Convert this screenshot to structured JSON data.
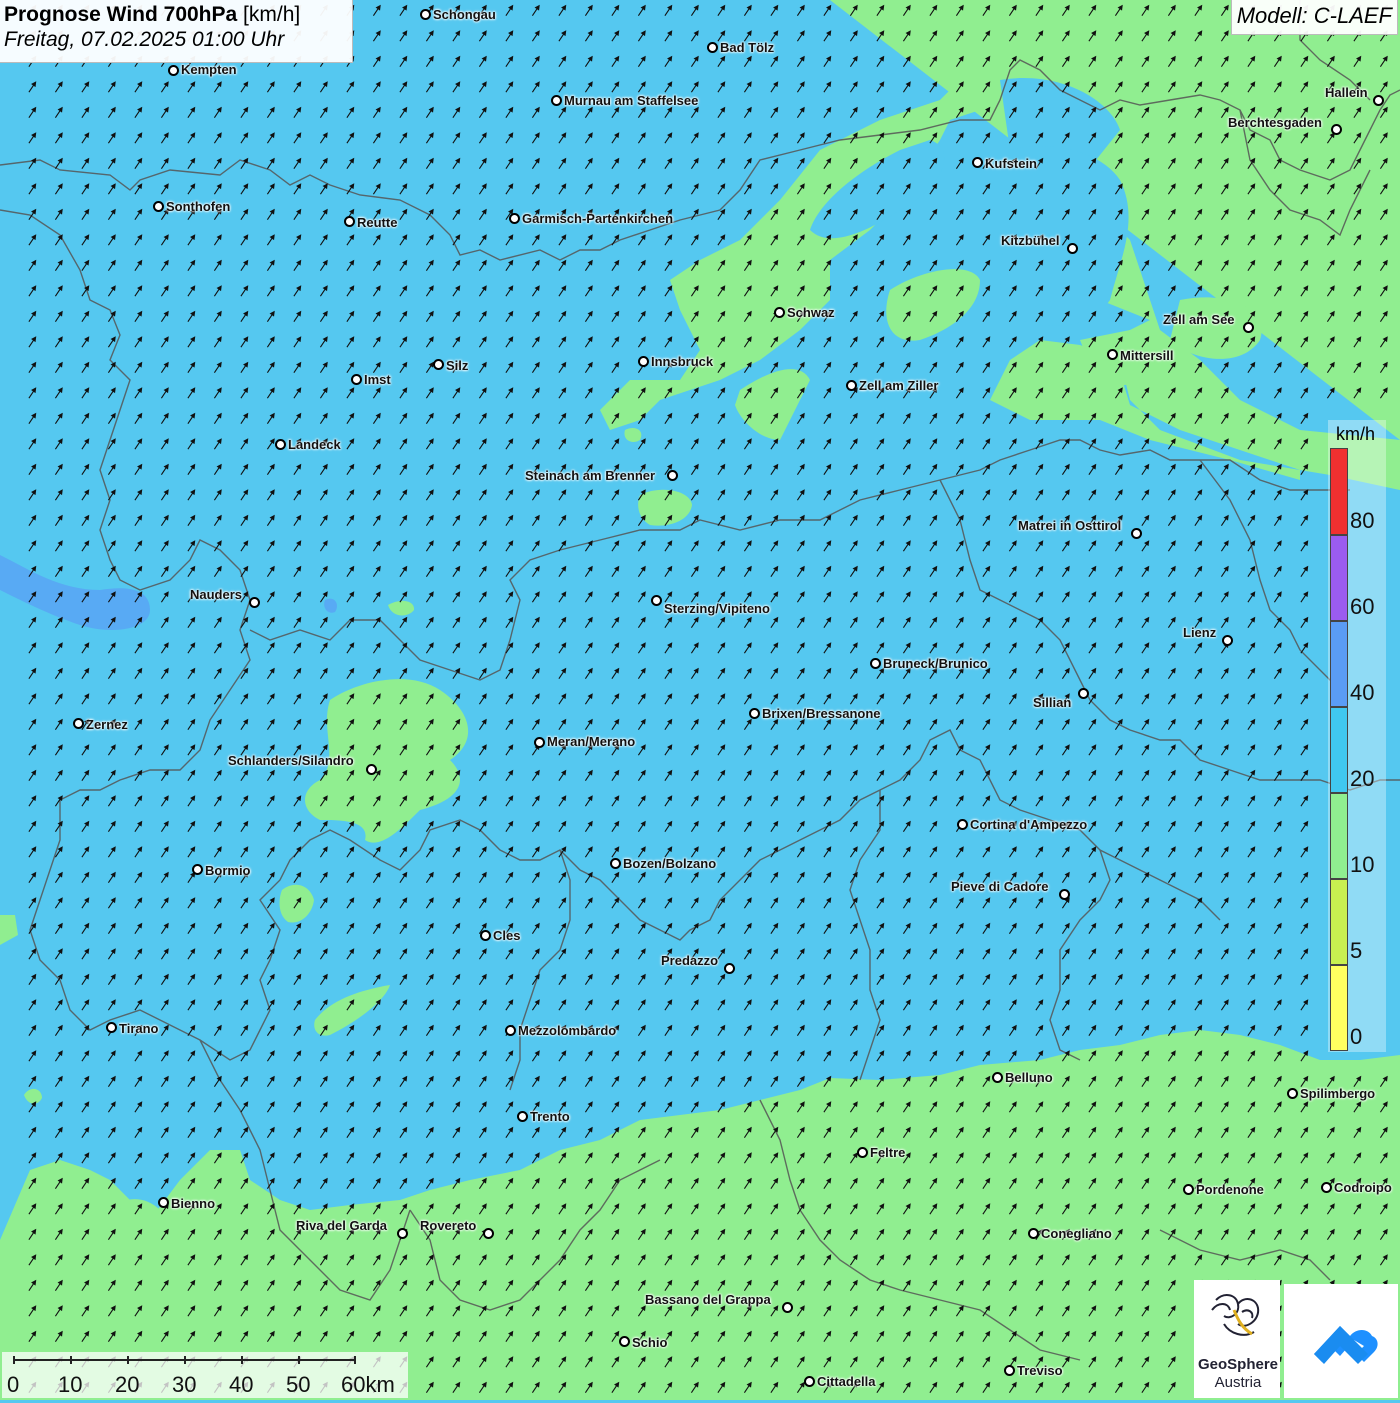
{
  "title": {
    "main_bold": "Prognose Wind 700hPa",
    "unit": "[km/h]",
    "subtitle": "Freitag, 07.02.2025 01:00 Uhr"
  },
  "model": "Modell: C-LAEF",
  "colors": {
    "wind_20_40": "#55c8f0",
    "wind_10_20": "#90ee90",
    "wind_40_60": "#5a9cf5",
    "borders": "#555555"
  },
  "legend": {
    "unit": "km/h",
    "labels": [
      "80",
      "60",
      "40",
      "20",
      "10",
      "5",
      "0"
    ],
    "segments": [
      {
        "color": "#f03030"
      },
      {
        "color": "#9b5cf0"
      },
      {
        "color": "#5a9cf5"
      },
      {
        "color": "#40c8f0"
      },
      {
        "color": "#90ee90"
      },
      {
        "color": "#c8f050"
      },
      {
        "color": "#ffff60"
      }
    ]
  },
  "scale": {
    "labels": [
      "0",
      "10",
      "20",
      "30",
      "40",
      "50",
      "60km"
    ]
  },
  "cities": [
    {
      "name": "Schongau"
    },
    {
      "name": "Bad Tölz"
    },
    {
      "name": "Kempten"
    },
    {
      "name": "Murnau am Staffelsee"
    },
    {
      "name": "Hallein"
    },
    {
      "name": "Berchtesgaden"
    },
    {
      "name": "Kufstein"
    },
    {
      "name": "Sonthofen"
    },
    {
      "name": "Reutte"
    },
    {
      "name": "Garmisch-Partenkirchen"
    },
    {
      "name": "Kitzbühel"
    },
    {
      "name": "Schwaz"
    },
    {
      "name": "Zell am See"
    },
    {
      "name": "Mittersill"
    },
    {
      "name": "Innsbruck"
    },
    {
      "name": "Silz"
    },
    {
      "name": "Imst"
    },
    {
      "name": "Zell am Ziller"
    },
    {
      "name": "Landeck"
    },
    {
      "name": "Steinach am Brenner"
    },
    {
      "name": "Matrei in Osttirol"
    },
    {
      "name": "Nauders"
    },
    {
      "name": "Sterzing/Vipiteno"
    },
    {
      "name": "Lienz"
    },
    {
      "name": "Bruneck/Brunico"
    },
    {
      "name": "Sillian"
    },
    {
      "name": "Brixen/Bressanone"
    },
    {
      "name": "Zernez"
    },
    {
      "name": "Meran/Merano"
    },
    {
      "name": "Schlanders/Silandro"
    },
    {
      "name": "Cortina d'Ampezzo"
    },
    {
      "name": "Bozen/Bolzano"
    },
    {
      "name": "Bormio"
    },
    {
      "name": "Pieve di Cadore"
    },
    {
      "name": "Cles"
    },
    {
      "name": "Predazzo"
    },
    {
      "name": "Tirano"
    },
    {
      "name": "Mezzolombardo"
    },
    {
      "name": "Belluno"
    },
    {
      "name": "Spilimbergo"
    },
    {
      "name": "Trento"
    },
    {
      "name": "Feltre"
    },
    {
      "name": "Pordenone"
    },
    {
      "name": "Codroipo"
    },
    {
      "name": "Bienno"
    },
    {
      "name": "Riva del Garda"
    },
    {
      "name": "Rovereto"
    },
    {
      "name": "Conegliano"
    },
    {
      "name": "Bassano del Grappa"
    },
    {
      "name": "Schio"
    },
    {
      "name": "Treviso"
    },
    {
      "name": "Cittadella"
    }
  ],
  "logos": {
    "geosphere_line1": "GeoSphere",
    "geosphere_line2": "Austria"
  }
}
